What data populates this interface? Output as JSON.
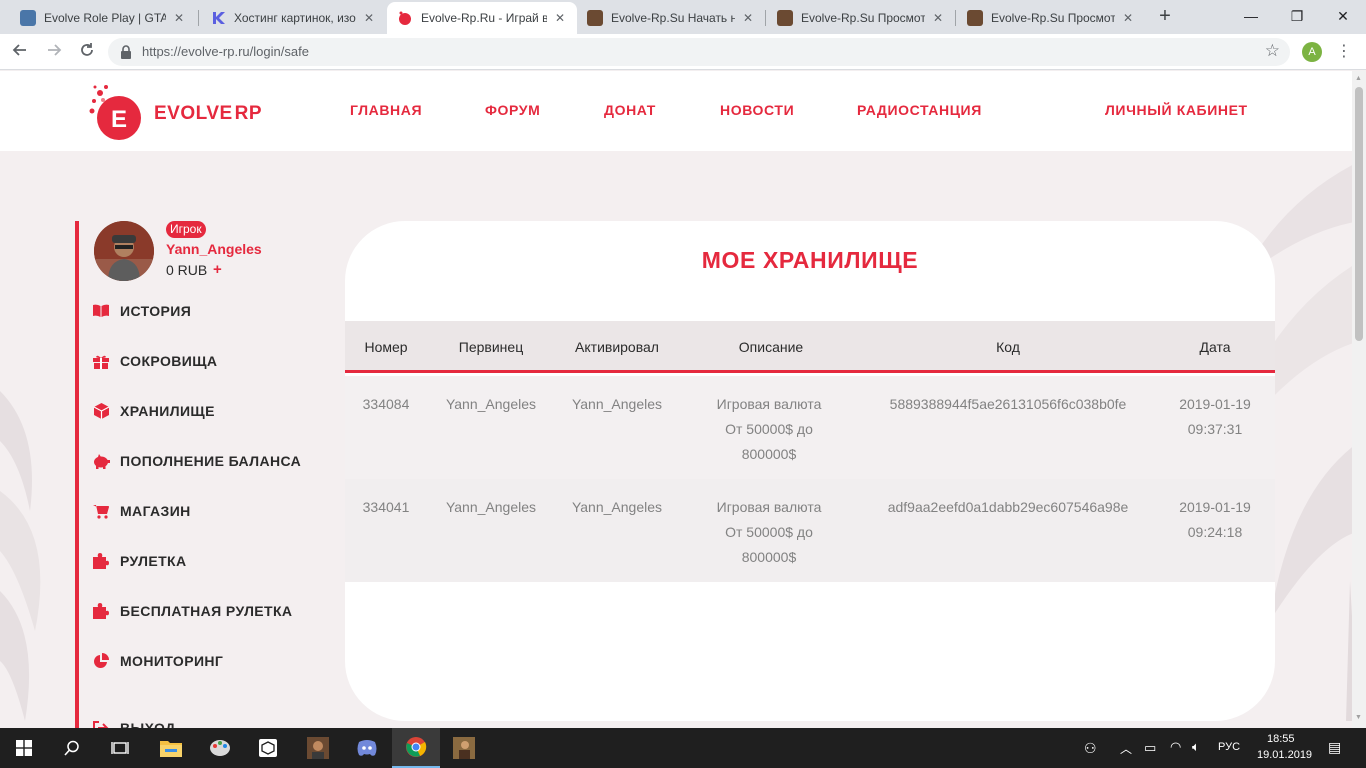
{
  "browser": {
    "tabs": [
      {
        "title": "Evolve Role Play | GTA S"
      },
      {
        "title": "Хостинг картинок, изо"
      },
      {
        "title": "Evolve-Rp.Ru - Играй в"
      },
      {
        "title": "Evolve-Rp.Su Начать н"
      },
      {
        "title": "Evolve-Rp.Su Просмотр"
      },
      {
        "title": "Evolve-Rp.Su Просмотр"
      }
    ],
    "url_host": "https://evolve-rp.ru",
    "url_path": "/login/safe",
    "profile_initial": "A"
  },
  "site": {
    "brand_evolve": "EVOLVE",
    "brand_rp": "RP",
    "logo_letter": "E",
    "nav": [
      "ГЛАВНАЯ",
      "ФОРУМ",
      "ДОНАТ",
      "НОВОСТИ",
      "РАДИОСТАНЦИЯ",
      "ЛИЧНЫЙ КАБИНЕТ"
    ],
    "accent_color": "#e5293e"
  },
  "user": {
    "role": "Игрок",
    "name": "Yann_Angeles",
    "balance": "0 RUB",
    "balance_add": "+"
  },
  "sidebar": {
    "items": [
      {
        "label": "ИСТОРИЯ",
        "icon": "book-icon"
      },
      {
        "label": "СОКРОВИЩА",
        "icon": "gift-icon"
      },
      {
        "label": "ХРАНИЛИЩЕ",
        "icon": "cube-icon"
      },
      {
        "label": "ПОПОЛНЕНИЕ БАЛАНСА",
        "icon": "piggy-bank-icon"
      },
      {
        "label": "МАГАЗИН",
        "icon": "cart-icon"
      },
      {
        "label": "РУЛЕТКА",
        "icon": "puzzle-icon"
      },
      {
        "label": "БЕСПЛАТНАЯ РУЛЕТКА",
        "icon": "puzzle-icon"
      },
      {
        "label": "МОНИТОРИНГ",
        "icon": "pie-chart-icon"
      },
      {
        "label": "ВЫХОД",
        "icon": "logout-icon"
      }
    ]
  },
  "storage": {
    "title": "МОЕ ХРАНИЛИЩЕ",
    "columns": [
      "Номер",
      "Первинец",
      "Активировал",
      "Описание",
      "Код",
      "Дата"
    ],
    "rows": [
      {
        "number": "334084",
        "first": "Yann_Angeles",
        "activated": "Yann_Angeles",
        "description_1": "Игровая валюта",
        "description_2": "От 50000$ до",
        "description_3": "800000$",
        "code": "5889388944f5ae26131056f6c038b0fe",
        "date": "2019-01-19",
        "time": "09:37:31"
      },
      {
        "number": "334041",
        "first": "Yann_Angeles",
        "activated": "Yann_Angeles",
        "description_1": "Игровая валюта",
        "description_2": "От 50000$ до",
        "description_3": "800000$",
        "code": "adf9aa2eefd0a1dabb29ec607546a98e",
        "date": "2019-01-19",
        "time": "09:24:18"
      }
    ]
  },
  "taskbar": {
    "language": "РУС",
    "time": "18:55",
    "date": "19.01.2019"
  }
}
